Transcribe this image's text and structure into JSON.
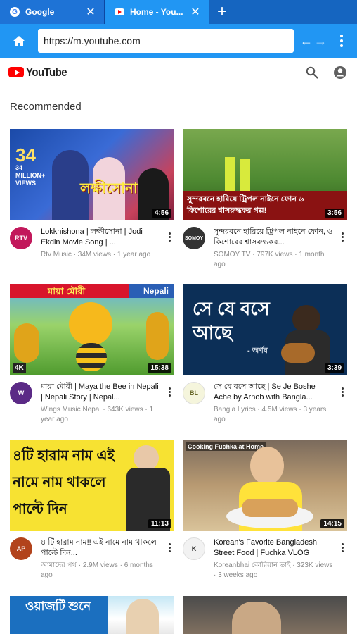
{
  "browser": {
    "tabs": [
      {
        "title": "Google",
        "active": false
      },
      {
        "title": "Home - You...",
        "active": true
      }
    ],
    "new_tab_label": "+",
    "close_glyph": "✕",
    "url": "https://m.youtube.com"
  },
  "header": {
    "logo_text": "YouTube",
    "search_icon": "search-icon",
    "account_icon": "account-icon"
  },
  "section_title": "Recommended",
  "videos": [
    {
      "title": "Lokkhishona | লক্ষীসোনা | Jodi Ekdin Movie Song | ...",
      "channel": "Rtv Music · 34M views · 1 year ago",
      "duration": "4:56",
      "thumb_text": "34 MILLION+ VIEWS",
      "avatar_text": "RTV",
      "avatar_color": "#c2185b"
    },
    {
      "title": "সুন্দরবনে হারিয়ে ট্রিপল নাইনে ফোন, ৬ কিশোরের শ্বাসরুদ্ধকর...",
      "channel": "SOMOY TV · 797K views · 1 month ago",
      "duration": "3:56",
      "thumb_text": "সুন্দরবনে হারিয়ে ট্রিপল নাইনে ফোন ৬ কিশোরের শ্বাসরুদ্ধকর গল্প!",
      "avatar_text": "SOMOY",
      "avatar_color": "#333333"
    },
    {
      "title": "মায়া মৌরী | Maya the Bee in Nepali | Nepali Story | Nepal...",
      "channel": "Wings Music Nepal · 643K views · 1 year ago",
      "duration": "15:38",
      "thumb_text": "মায়া মৌরী",
      "thumb_tag": "Nepali",
      "thumb_badge": "4K",
      "avatar_text": "W",
      "avatar_color": "#5b2a86"
    },
    {
      "title": "সে যে বসে আছে | Se Je Boshe Ache by Arnob with Bangla...",
      "channel": "Bangla Lyrics · 4.5M views · 3 years ago",
      "duration": "3:39",
      "thumb_text": "সে যে বসে আছে",
      "thumb_sub": "- অর্ণব",
      "avatar_text": "BL",
      "avatar_color": "#d9d98a"
    },
    {
      "title": "৪ টি হারাম নাম!! এই নামে নাম থাকলে পাল্টে দিন...",
      "channel": "আমাদের পথ · 2.9M views · 6 months ago",
      "duration": "11:13",
      "thumb_text": "৪টি হারাম নাম এই নামে নাম থাকলে পাল্টে দিন",
      "avatar_text": "AP",
      "avatar_color": "#b2431c"
    },
    {
      "title": "Korean's Favorite Bangladesh Street Food | Fuchka VLOG",
      "channel": "Koreanbhai কোরিয়ান ভাই · 323K views · 3 weeks ago",
      "duration": "14:15",
      "thumb_text": "Cooking Fuchka at Home",
      "avatar_text": "K",
      "avatar_color": "#f2f2f2"
    },
    {
      "title": "",
      "channel": "",
      "duration": "",
      "thumb_text": "ওয়াজটি শুনে",
      "avatar_text": "",
      "avatar_color": "#ffffff"
    },
    {
      "title": "",
      "channel": "",
      "duration": "",
      "thumb_text": "",
      "avatar_text": "",
      "avatar_color": "#ffffff"
    }
  ]
}
